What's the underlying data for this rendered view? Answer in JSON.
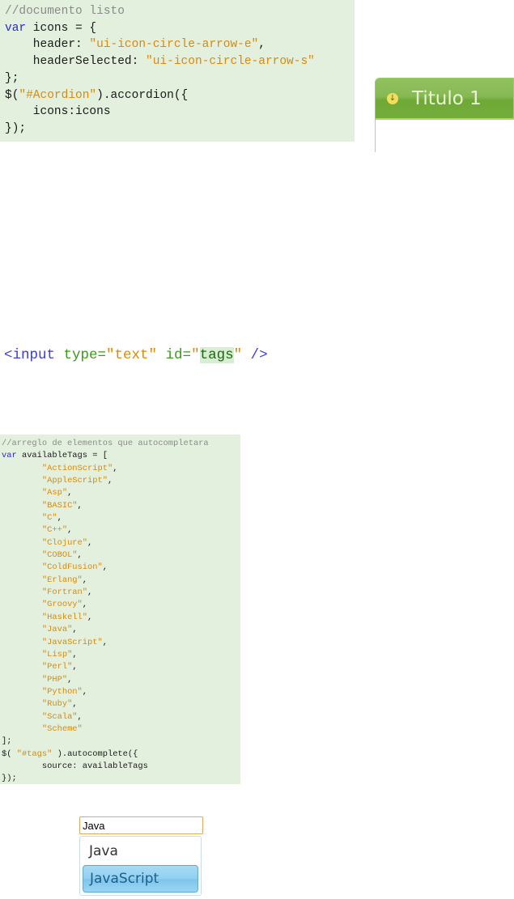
{
  "accordion_code": [
    [
      {
        "t": "//documento listo",
        "c": "comment"
      }
    ],
    [
      {
        "t": "var",
        "c": "keyword"
      },
      {
        "t": " icons = {",
        "c": "plain"
      }
    ],
    [
      {
        "t": "    header: ",
        "c": "plain"
      },
      {
        "t": "\"ui-icon-circle-arrow-e\"",
        "c": "string"
      },
      {
        "t": ",",
        "c": "plain"
      }
    ],
    [
      {
        "t": "    headerSelected: ",
        "c": "plain"
      },
      {
        "t": "\"ui-icon-circle-arrow-s\"",
        "c": "string"
      }
    ],
    [
      {
        "t": "};",
        "c": "plain"
      }
    ],
    [
      {
        "t": "$(",
        "c": "plain"
      },
      {
        "t": "\"#Acordion\"",
        "c": "string"
      },
      {
        "t": ").accordion({",
        "c": "plain"
      }
    ],
    [
      {
        "t": "    icons:icons",
        "c": "plain"
      }
    ],
    [
      {
        "t": "});",
        "c": "plain"
      }
    ]
  ],
  "accordion_demo": {
    "header_title": "Titulo 1",
    "icon": "circle-arrow-s-icon",
    "header_color": "#7db446"
  },
  "html_line": [
    {
      "t": "<input ",
      "c": "tag"
    },
    {
      "t": "type=",
      "c": "attr"
    },
    {
      "t": "\"text\"",
      "c": "string"
    },
    {
      "t": " id=",
      "c": "attr"
    },
    {
      "t": "\"",
      "c": "string"
    },
    {
      "t": "tags",
      "c": "hl"
    },
    {
      "t": "\"",
      "c": "string"
    },
    {
      "t": " />",
      "c": "tag"
    }
  ],
  "autocomplete_code": [
    [
      {
        "t": "//arreglo de elementos que autocompletara",
        "c": "comment"
      }
    ],
    [
      {
        "t": "var",
        "c": "keyword"
      },
      {
        "t": " availableTags = [",
        "c": "plain"
      }
    ],
    [
      {
        "t": "        ",
        "c": "plain"
      },
      {
        "t": "\"ActionScript\"",
        "c": "string"
      },
      {
        "t": ",",
        "c": "plain"
      }
    ],
    [
      {
        "t": "        ",
        "c": "plain"
      },
      {
        "t": "\"AppleScript\"",
        "c": "string"
      },
      {
        "t": ",",
        "c": "plain"
      }
    ],
    [
      {
        "t": "        ",
        "c": "plain"
      },
      {
        "t": "\"Asp\"",
        "c": "string"
      },
      {
        "t": ",",
        "c": "plain"
      }
    ],
    [
      {
        "t": "        ",
        "c": "plain"
      },
      {
        "t": "\"BASIC\"",
        "c": "string"
      },
      {
        "t": ",",
        "c": "plain"
      }
    ],
    [
      {
        "t": "        ",
        "c": "plain"
      },
      {
        "t": "\"C\"",
        "c": "string"
      },
      {
        "t": ",",
        "c": "plain"
      }
    ],
    [
      {
        "t": "        ",
        "c": "plain"
      },
      {
        "t": "\"C++\"",
        "c": "string"
      },
      {
        "t": ",",
        "c": "plain"
      }
    ],
    [
      {
        "t": "        ",
        "c": "plain"
      },
      {
        "t": "\"Clojure\"",
        "c": "string"
      },
      {
        "t": ",",
        "c": "plain"
      }
    ],
    [
      {
        "t": "        ",
        "c": "plain"
      },
      {
        "t": "\"COBOL\"",
        "c": "string"
      },
      {
        "t": ",",
        "c": "plain"
      }
    ],
    [
      {
        "t": "        ",
        "c": "plain"
      },
      {
        "t": "\"ColdFusion\"",
        "c": "string"
      },
      {
        "t": ",",
        "c": "plain"
      }
    ],
    [
      {
        "t": "        ",
        "c": "plain"
      },
      {
        "t": "\"Erlang\"",
        "c": "string"
      },
      {
        "t": ",",
        "c": "plain"
      }
    ],
    [
      {
        "t": "        ",
        "c": "plain"
      },
      {
        "t": "\"Fortran\"",
        "c": "string"
      },
      {
        "t": ",",
        "c": "plain"
      }
    ],
    [
      {
        "t": "        ",
        "c": "plain"
      },
      {
        "t": "\"Groovy\"",
        "c": "string"
      },
      {
        "t": ",",
        "c": "plain"
      }
    ],
    [
      {
        "t": "        ",
        "c": "plain"
      },
      {
        "t": "\"Haskell\"",
        "c": "string"
      },
      {
        "t": ",",
        "c": "plain"
      }
    ],
    [
      {
        "t": "        ",
        "c": "plain"
      },
      {
        "t": "\"Java\"",
        "c": "string"
      },
      {
        "t": ",",
        "c": "plain"
      }
    ],
    [
      {
        "t": "        ",
        "c": "plain"
      },
      {
        "t": "\"JavaScript\"",
        "c": "string"
      },
      {
        "t": ",",
        "c": "plain"
      }
    ],
    [
      {
        "t": "        ",
        "c": "plain"
      },
      {
        "t": "\"Lisp\"",
        "c": "string"
      },
      {
        "t": ",",
        "c": "plain"
      }
    ],
    [
      {
        "t": "        ",
        "c": "plain"
      },
      {
        "t": "\"Perl\"",
        "c": "string"
      },
      {
        "t": ",",
        "c": "plain"
      }
    ],
    [
      {
        "t": "        ",
        "c": "plain"
      },
      {
        "t": "\"PHP\"",
        "c": "string"
      },
      {
        "t": ",",
        "c": "plain"
      }
    ],
    [
      {
        "t": "        ",
        "c": "plain"
      },
      {
        "t": "\"Python\"",
        "c": "string"
      },
      {
        "t": ",",
        "c": "plain"
      }
    ],
    [
      {
        "t": "        ",
        "c": "plain"
      },
      {
        "t": "\"Ruby\"",
        "c": "string"
      },
      {
        "t": ",",
        "c": "plain"
      }
    ],
    [
      {
        "t": "        ",
        "c": "plain"
      },
      {
        "t": "\"Scala\"",
        "c": "string"
      },
      {
        "t": ",",
        "c": "plain"
      }
    ],
    [
      {
        "t": "        ",
        "c": "plain"
      },
      {
        "t": "\"Scheme\"",
        "c": "string"
      }
    ],
    [
      {
        "t": "];",
        "c": "plain"
      }
    ],
    [
      {
        "t": "$( ",
        "c": "plain"
      },
      {
        "t": "\"#tags\"",
        "c": "string"
      },
      {
        "t": " ).autocomplete({",
        "c": "plain"
      }
    ],
    [
      {
        "t": "        source: availableTags",
        "c": "plain"
      }
    ],
    [
      {
        "t": "});",
        "c": "plain"
      }
    ]
  ],
  "autocomplete_demo": {
    "input_value": "Java",
    "suggestions": [
      "Java",
      "JavaScript"
    ],
    "selected_index": 1
  }
}
